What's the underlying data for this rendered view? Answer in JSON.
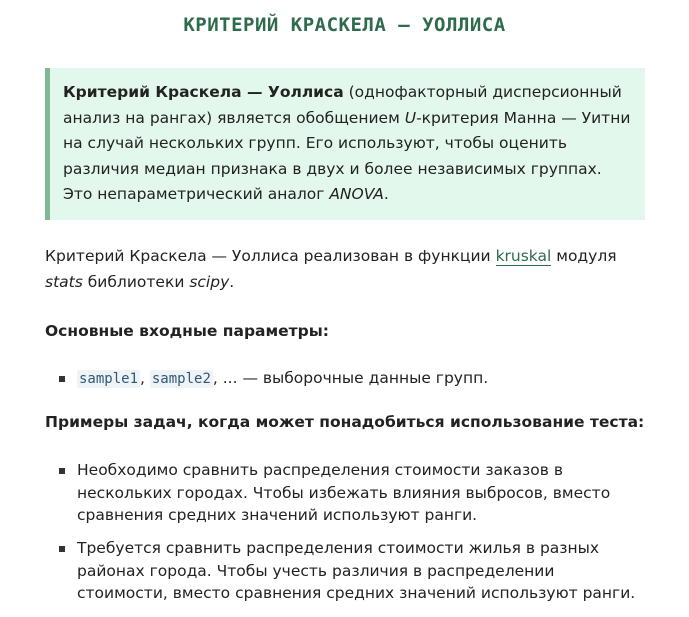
{
  "title": "КРИТЕРИЙ КРАСКЕЛА — УОЛЛИСА",
  "callout": {
    "term": "Критерий Краскела — Уоллиса",
    "text1": " (однофакторный дисперсионный анализ на рангах) является обобщением ",
    "u_letter": "U",
    "text2": "-критерия Манна — Уитни на случай нескольких групп. Его используют, чтобы оценить различия медиан признака в двух и более независимых группах. Это непараметрический аналог ",
    "anova": "ANOVA",
    "text3": "."
  },
  "para": {
    "text1": "Критерий Краскела — Уоллиса реализован в функции ",
    "link": "kruskal",
    "text2": " модуля ",
    "stats": "stats",
    "text3": " библиотеки ",
    "scipy": "scipy",
    "text4": "."
  },
  "params_heading": "Основные входные параметры:",
  "params": {
    "code1": "sample1",
    "sep": ", ",
    "code2": "sample2",
    "rest": ", ... — выборочные данные групп."
  },
  "examples_heading": "Примеры задач, когда может понадобиться использование теста:",
  "examples": [
    "Необходимо сравнить распределения стоимости заказов в нескольких городах. Чтобы избежать влияния выбросов, вместо сравнения средних значений используют ранги.",
    "Требуется сравнить распределения стоимости жилья в разных районах города. Чтобы учесть различия в распределении стоимости, вместо сравнения средних значений используют ранги."
  ],
  "colors": {
    "accent": "#2e6b4c",
    "callout_bg": "#e2f8ec",
    "callout_border": "#7fb893",
    "text": "#222222"
  }
}
